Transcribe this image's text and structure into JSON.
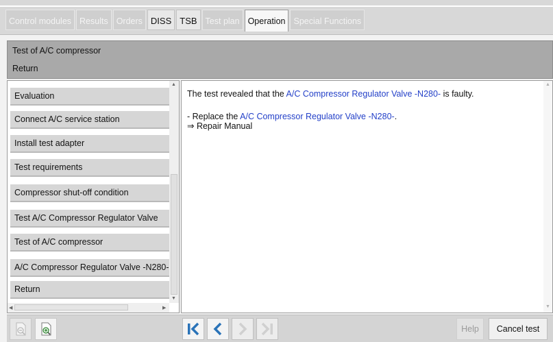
{
  "tabs": [
    {
      "label": "Control modules",
      "state": "disabled"
    },
    {
      "label": "Results",
      "state": "disabled"
    },
    {
      "label": "Orders",
      "state": "disabled"
    },
    {
      "label": "DISS",
      "state": "enabled"
    },
    {
      "label": "TSB",
      "state": "enabled"
    },
    {
      "label": "Test plan",
      "state": "disabled"
    },
    {
      "label": "Operation",
      "state": "active"
    },
    {
      "label": "Special Functions",
      "state": "disabled"
    }
  ],
  "header": {
    "title": "Test of A/C compressor",
    "return_label": "Return"
  },
  "steps": [
    "Evaluation",
    "Connect A/C service station",
    "Install test adapter",
    "Test requirements",
    "Compressor shut-off condition",
    "Test A/C Compressor Regulator Valve",
    "Test of A/C compressor",
    "A/C Compressor Regulator Valve -N280-",
    "Return"
  ],
  "content": {
    "result_prefix": "The test revealed that the ",
    "result_link": "A/C Compressor Regulator Valve -N280-",
    "result_suffix": " is faulty.",
    "replace_prefix": "- Replace the ",
    "replace_link": "A/C Compressor Regulator Valve -N280-",
    "replace_suffix": ".",
    "repair_manual": "⇒ Repair Manual"
  },
  "toolbar": {
    "help_label": "Help",
    "cancel_label": "Cancel test"
  },
  "colors": {
    "nav_active": "#2a73b8",
    "nav_disabled": "#d0d0d0",
    "link": "#2340c8"
  }
}
